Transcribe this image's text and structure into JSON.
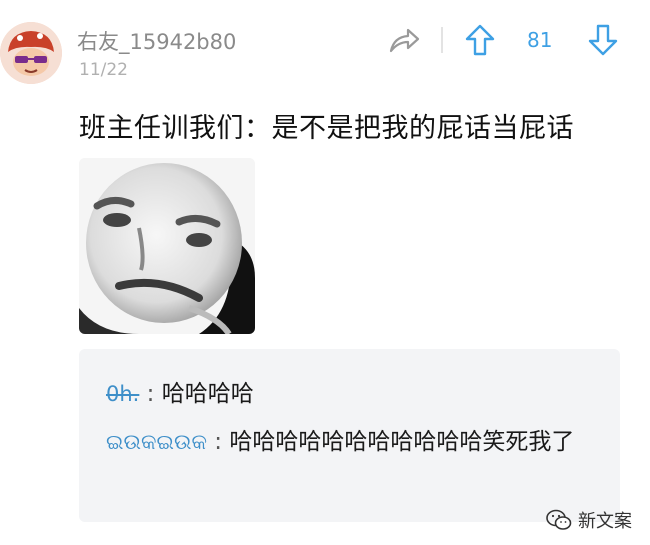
{
  "post": {
    "username": "右友_15942b80",
    "date": "11/22",
    "vote_count": "81",
    "text": "班主任训我们：是不是把我的屁话当屁话"
  },
  "replies": [
    {
      "author": "0h.",
      "separator": " : ",
      "text": "哈哈哈哈"
    },
    {
      "author": "ଇଉକଇଉକ",
      "separator": " : ",
      "text": "哈哈哈哈哈哈哈哈哈哈哈笑死我了"
    }
  ],
  "watermark": {
    "text": "新文案"
  },
  "icons": {
    "share": "share-arrow-icon",
    "upvote": "up-arrow-icon",
    "downvote": "down-arrow-icon",
    "watermark": "wechat-icon"
  },
  "colors": {
    "accent_blue": "#3ea0e4",
    "username_gray": "#8a8a8a",
    "reply_bg": "#f3f4f6"
  }
}
